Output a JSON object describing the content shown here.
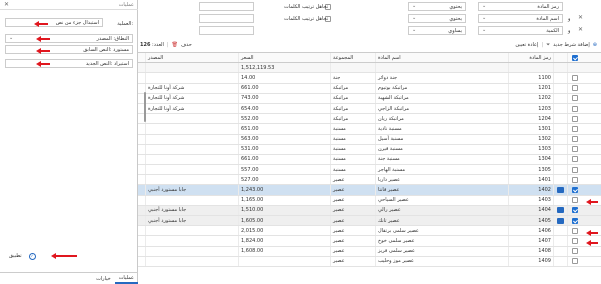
{
  "left_panel": {
    "title": "عمليات",
    "operation_label": "العملية:",
    "operation_value": "استبدال جزء من نص",
    "fields": [
      {
        "key_label": "النطاق:",
        "value": "المصدر"
      },
      {
        "key_label": "النص السابق:",
        "value": "مستورد"
      },
      {
        "key_label": "النص الجديد:",
        "value": "استيراد"
      }
    ],
    "apply_label": "تطبيق",
    "tabs": [
      "عمليات",
      "خيارات"
    ]
  },
  "filters": {
    "row1": {
      "field": "رمز المادة",
      "op": "يحتوي",
      "value": "",
      "ignore_order": "تجاهل ترتيب الكلمات"
    },
    "row2": {
      "field": "اسم المادة",
      "op": "يحتوي",
      "value": "",
      "ignore_order": "تجاهل ترتيب الكلمات",
      "conj": "و"
    },
    "row3": {
      "field": "الكمية",
      "op": "يساوي",
      "value": "",
      "conj": "و"
    }
  },
  "toolbar": {
    "add_filter": "إضافة شرط جديد",
    "reset": "إعادة تعيين",
    "delete": "حذف",
    "count_label": "العدد:",
    "count_value": "126"
  },
  "table": {
    "headers": [
      "",
      "رمز المادة",
      "اسم المادة",
      "المجموعة",
      "السعر",
      "المصدر"
    ],
    "total_price": "1,512,119.53",
    "rows": [
      {
        "code": "1100",
        "name": "جنة دوائر",
        "group": "جنة",
        "price": "14.00",
        "source": "",
        "checked": false,
        "hl": ""
      },
      {
        "code": "1201",
        "name": "مراتبكة بوتيوم",
        "group": "مراتبكة",
        "price": "661.00",
        "source": "شركة أونا للتجارة",
        "checked": false,
        "hl": ""
      },
      {
        "code": "1202",
        "name": "مراتبكة الشهبة",
        "group": "مراتبكة",
        "price": "743.00",
        "source": "شركة أونا للتجارة",
        "checked": false,
        "hl": ""
      },
      {
        "code": "1203",
        "name": "مراتبكة الزاجي",
        "group": "مراتبكة",
        "price": "654.00",
        "source": "شركة أونا للتجارة",
        "checked": false,
        "hl": ""
      },
      {
        "code": "1204",
        "name": "مراتبكة ريان",
        "group": "مراتبكة",
        "price": "552.00",
        "source": "",
        "checked": false,
        "hl": ""
      },
      {
        "code": "1301",
        "name": "مسنبة نادية",
        "group": "مسنبة",
        "price": "651.00",
        "source": "",
        "checked": false,
        "hl": ""
      },
      {
        "code": "1302",
        "name": "مسنبة أسيل",
        "group": "مسنبة",
        "price": "563.00",
        "source": "",
        "checked": false,
        "hl": ""
      },
      {
        "code": "1303",
        "name": "مسنبة فيرن",
        "group": "مسنبة",
        "price": "531.00",
        "source": "",
        "checked": false,
        "hl": ""
      },
      {
        "code": "1304",
        "name": "مسنبة جنة",
        "group": "مسنبة",
        "price": "661.00",
        "source": "",
        "checked": false,
        "hl": ""
      },
      {
        "code": "1305",
        "name": "مسنبة الهاجر",
        "group": "مسنبة",
        "price": "557.00",
        "source": "",
        "checked": false,
        "hl": ""
      },
      {
        "code": "1401",
        "name": "عصير داربا",
        "group": "عصير",
        "price": "527.00",
        "source": "",
        "checked": false,
        "hl": ""
      },
      {
        "code": "1402",
        "name": "عصير فانتا",
        "group": "عصير",
        "price": "1,243.00",
        "source": "جابا مستورد أجنبي",
        "checked": true,
        "hl": "sel"
      },
      {
        "code": "1403",
        "name": "عصير السياحي",
        "group": "عصير",
        "price": "1,165.00",
        "source": "",
        "checked": false,
        "hl": ""
      },
      {
        "code": "1404",
        "name": "عصير رالي",
        "group": "عصير",
        "price": "1,510.00",
        "source": "جابا مستورد أجنبي",
        "checked": true,
        "hl": "gray"
      },
      {
        "code": "1405",
        "name": "عصير تانك",
        "group": "عصير",
        "price": "1,605.00",
        "source": "جابا مستورد أجنبي",
        "checked": true,
        "hl": "gray"
      },
      {
        "code": "1406",
        "name": "عصير سلمى برتقال",
        "group": "عصير",
        "price": "2,015.00",
        "source": "",
        "checked": false,
        "hl": ""
      },
      {
        "code": "1407",
        "name": "عصير سلمى خوخ",
        "group": "عصير",
        "price": "1,824.00",
        "source": "",
        "checked": false,
        "hl": ""
      },
      {
        "code": "1408",
        "name": "عصير سلمى فريز",
        "group": "عصير",
        "price": "1,608.00",
        "source": "",
        "checked": false,
        "hl": ""
      },
      {
        "code": "1409",
        "name": "عصير موز وحليب",
        "group": "عصير",
        "price": "",
        "source": "",
        "checked": false,
        "hl": ""
      }
    ]
  },
  "colors": {
    "accent": "#2569c0",
    "selected_row": "#cfe0f1",
    "arrow": "#e0161e"
  }
}
